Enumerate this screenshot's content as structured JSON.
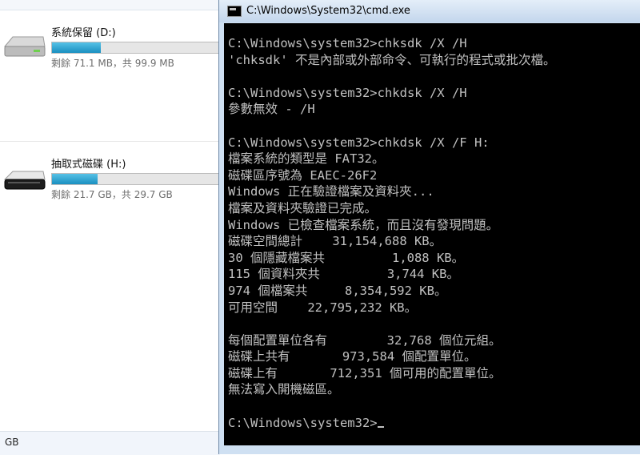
{
  "explorer": {
    "drives": [
      {
        "name": "系統保留 (D:)",
        "space": "剩餘 71.1 MB，共 99.9 MB",
        "used_fraction": 0.29
      },
      {
        "name": "抽取式磁碟 (H:)",
        "space": "剩餘 21.7 GB，共 29.7 GB",
        "used_fraction": 0.27
      }
    ],
    "status_text": "GB"
  },
  "cmd": {
    "title": "C:\\Windows\\System32\\cmd.exe",
    "lines": [
      "C:\\Windows\\system32>chksdk /X /H",
      "'chksdk' 不是內部或外部命令、可執行的程式或批次檔。",
      "",
      "C:\\Windows\\system32>chkdsk /X /H",
      "參數無效 - /H",
      "",
      "C:\\Windows\\system32>chkdsk /X /F H:",
      "檔案系統的類型是 FAT32。",
      "磁碟區序號為 EAEC-26F2",
      "Windows 正在驗證檔案及資料夾...",
      "檔案及資料夾驗證已完成。",
      "Windows 已檢查檔案系統，而且沒有發現問題。",
      "磁碟空間總計    31,154,688 KB。",
      "30 個隱藏檔案共         1,088 KB。",
      "115 個資料夾共         3,744 KB。",
      "974 個檔案共     8,354,592 KB。",
      "可用空間    22,795,232 KB。",
      "",
      "每個配置單位各有        32,768 個位元組。",
      "磁碟上共有       973,584 個配置單位。",
      "磁碟上有       712,351 個可用的配置單位。",
      "無法寫入開機磁區。",
      "",
      "C:\\Windows\\system32>"
    ]
  }
}
